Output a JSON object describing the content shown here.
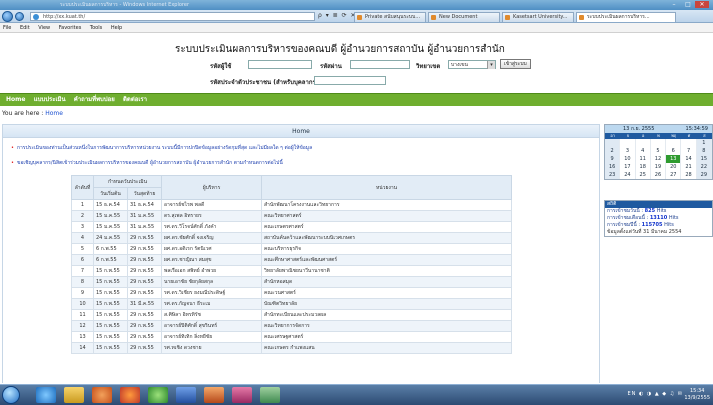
{
  "browser": {
    "window_title": "ระบบประเมินผลการบริหาร - Windows Internet Explorer",
    "url": "http://xx.kuat.th/",
    "url_icons": "ρ ▾ ≣ ⟳ ✕",
    "tabs": [
      {
        "label": "Private สนับสนุนระบบ..."
      },
      {
        "label": "New Document"
      },
      {
        "label": "Kasetsart University..."
      },
      {
        "label": "ระบบประเมินผลการบริหาร..."
      }
    ],
    "menu": [
      "File",
      "Edit",
      "View",
      "Favorites",
      "Tools",
      "Help"
    ]
  },
  "header": {
    "title": "ระบบประเมินผลการบริหารของคณบดี ผู้อำนวยการสถาบัน ผู้อำนวยการสำนัก",
    "username_label": "รหัสผู้ใช้",
    "password_label": "รหัสผ่าน",
    "campus_label": "วิทยาเขต",
    "campus_value": "บางเขน",
    "login_button": "เข้าสู่ระบบ",
    "idcard_label": "รหัสประจำตัวประชาชน (สำหรับบุคลากร)"
  },
  "nav": {
    "items": [
      "Home",
      "แบบประเมิน",
      "คำถามที่พบบ่อย",
      "ติดต่อเรา"
    ]
  },
  "breadcrumb": {
    "prefix": "You are here :",
    "link": "Home"
  },
  "main": {
    "panel_title": "Home",
    "note1": "การประเมินของท่านเป็นส่วนหนึ่งในการพัฒนาการบริหารหน่วยงาน ระบบนี้มีการปกปิดข้อมูลอย่างรัดกุมที่สุด และไม่มีผลใด ๆ ต่อผู้ให้ข้อมูล",
    "note2": "ขอเชิญบุคลากร/นิสิตเข้าร่วมประเมินผลการบริหารของคณบดี ผู้อำนวยการสถาบัน ผู้อำนวยการสำนัก ตามกำหนดการต่อไปนี้",
    "table": {
      "col_no": "ลำดับที่",
      "col_period": "กำหนดวันประเมิน",
      "col_start": "วันเริ่มต้น",
      "col_end": "วันสุดท้าย",
      "col_admin": "ผู้บริหาร",
      "col_unit": "หน่วยงาน",
      "rows": [
        {
          "no": "1",
          "start": "15 ธ.ค.54",
          "end": "31 ธ.ค.54",
          "admin": "อาจารย์ชไรพ  พลดี",
          "unit": "สำนักพัฒนาโครงงานและวิทยาการ"
        },
        {
          "no": "2",
          "start": "15 ม.ค.55",
          "end": "31 ม.ค.55",
          "admin": "ดร.สุเพล อิทรายร",
          "unit": "คณะวิทยาศาสตร์"
        },
        {
          "no": "3",
          "start": "15 ม.ค.55",
          "end": "31 ม.ค.55",
          "admin": "รศ.ดร.วีโรจน์ศักดิ์ ภังคำ",
          "unit": "คณะเกษตรศาสตร์"
        },
        {
          "no": "4",
          "start": "24 ม.ค.55",
          "end": "29 ก.พ.55",
          "admin": "ผศ.ดร.ชัยศักดิ์ จงเจริญ",
          "unit": "สถาบันค้นคว้าและพัฒนาระบบนิเวศเกษตร"
        },
        {
          "no": "5",
          "start": "6 ก.พ.55",
          "end": "29 ก.พ.55",
          "admin": "ผศ.ดร.อดิเรก รัตนิเวศ",
          "unit": "คณะบริหารธุรกิจ"
        },
        {
          "no": "6",
          "start": "6 ก.พ.55",
          "end": "29 ก.พ.55",
          "admin": "ผศ.ดร.ชาญิณา สมสุข",
          "unit": "คณะศึกษาศาสตร์และพัฒนศาสตร์"
        },
        {
          "no": "7",
          "start": "15 ก.พ.55",
          "end": "29 ก.พ.55",
          "admin": "พลเรือเอก สพิทย์ อำพวย",
          "unit": "วิทยาลัยพาณิชยนาวีนานาชาติ"
        },
        {
          "no": "8",
          "start": "15 ก.พ.55",
          "end": "29 ก.พ.55",
          "admin": "นายเอาชัย ชัยกุลัยสกุล",
          "unit": "สำนักหอสมุด"
        },
        {
          "no": "9",
          "start": "15 ก.พ.55",
          "end": "29 ก.พ.55",
          "admin": "รศ.ดร.วิเชียร ยงมณีประดิษฐ์",
          "unit": "คณะวนศาสตร์"
        },
        {
          "no": "10",
          "start": "15 ก.พ.55",
          "end": "31 มี.ค.55",
          "admin": "รศ.ดร.กัญจนา ธีระเม",
          "unit": "บัณฑิตวิทยาลัย"
        },
        {
          "no": "11",
          "start": "15 ก.พ.55",
          "end": "29 ก.พ.55",
          "admin": "ส.ศิษิลา อิทรทิรัช",
          "unit": "สำนักทะเบียนและประมวลผล"
        },
        {
          "no": "12",
          "start": "15 ก.พ.55",
          "end": "29 ก.พ.55",
          "admin": "อาจารย์ปิติศักดิ์ สุขรินทร์",
          "unit": "คณะวิทยาการจัดการ"
        },
        {
          "no": "13",
          "start": "15 ก.พ.55",
          "end": "29 ก.พ.55",
          "admin": "อาจารย์ทิเทิก ลิ่งหยีชัย",
          "unit": "คณะเศรษฐศาสตร์"
        },
        {
          "no": "14",
          "start": "15 ก.พ.55",
          "end": "29 ก.พ.55",
          "admin": "รศ.ทเชิง ดวงชาย",
          "unit": "คณะเกษตร กำแพงแสน"
        }
      ]
    }
  },
  "calendar": {
    "month_label": "13 ก.ย. 2555",
    "clock": "15:34:59",
    "day_names": [
      "อา",
      "จ",
      "อ",
      "พ",
      "พฤ",
      "ศ",
      "ส"
    ],
    "weeks": [
      [
        "",
        "",
        "",
        "",
        "",
        "",
        "1"
      ],
      [
        "2",
        "3",
        "4",
        "5",
        "6",
        "7",
        "8"
      ],
      [
        "9",
        "10",
        "11",
        "12",
        "13",
        "14",
        "15"
      ],
      [
        "16",
        "17",
        "18",
        "19",
        "20",
        "21",
        "22"
      ],
      [
        "23",
        "24",
        "25",
        "26",
        "27",
        "28",
        "29"
      ]
    ],
    "today": "13"
  },
  "stats": {
    "header": "สถิติ",
    "today_label": "การเข้าชมวันนี้ :",
    "today_value": "825",
    "month_label": "การเข้าชมเดือนนี้ :",
    "month_value": "13110",
    "year_label": "การเข้าชมปีนี้ :",
    "year_value": "115705",
    "hits": "Hits",
    "since": "ข้อมูลตั้งแต่วันที่ 31 มีนาคม 2554"
  },
  "taskbar": {
    "clock_time": "15:34",
    "clock_date": "13/9/2555",
    "tray": "EN ◐ ◑ ▲ ◆ ♫ ✉"
  }
}
